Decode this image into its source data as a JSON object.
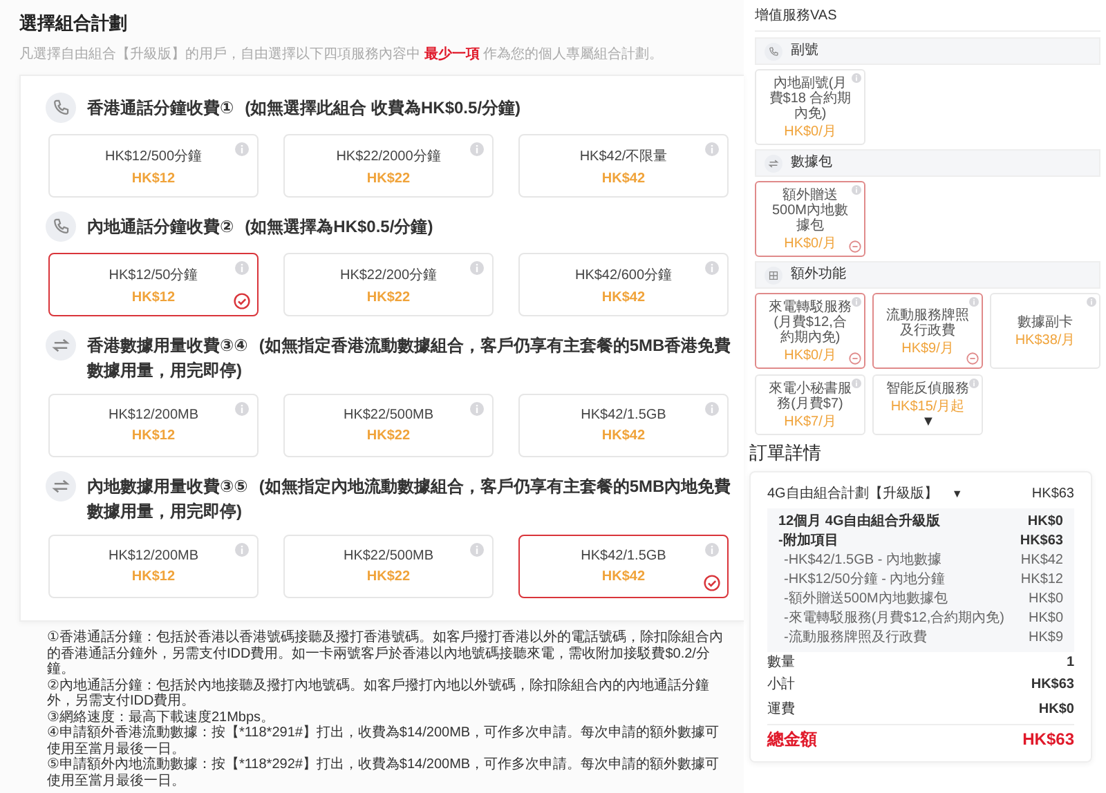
{
  "plan_section": {
    "title": "選擇組合計劃",
    "subtitle": "凡選擇自由組合【升級版】的用戶，自由選擇以下四項服務內容中 **最少一項** 作為您的個人專屬組合計劃。",
    "categories": [
      {
        "kind": "calls",
        "title": "香港通話分鐘收費①",
        "note": "(如無選擇此組合 收費為HK$0.5/分鐘)",
        "options": [
          {
            "name": "HK$12/500分鐘",
            "price": "HK$12",
            "selected": false
          },
          {
            "name": "HK$22/2000分鐘",
            "price": "HK$22",
            "selected": false
          },
          {
            "name": "HK$42/不限量",
            "price": "HK$42",
            "selected": false
          }
        ]
      },
      {
        "kind": "calls",
        "title": "內地通話分鐘收費②",
        "note": "(如無選擇為HK$0.5/分鐘)",
        "options": [
          {
            "name": "HK$12/50分鐘",
            "price": "HK$12",
            "selected": true
          },
          {
            "name": "HK$22/200分鐘",
            "price": "HK$22",
            "selected": false
          },
          {
            "name": "HK$42/600分鐘",
            "price": "HK$42",
            "selected": false
          }
        ]
      },
      {
        "kind": "data",
        "title": "香港數據用量收費③④",
        "note": "(如無指定香港流動數據組合，客戶仍享有主套餐的5MB香港免費數據用量，用完即停)",
        "options": [
          {
            "name": "HK$12/200MB",
            "price": "HK$12",
            "selected": false
          },
          {
            "name": "HK$22/500MB",
            "price": "HK$22",
            "selected": false
          },
          {
            "name": "HK$42/1.5GB",
            "price": "HK$42",
            "selected": false
          }
        ]
      },
      {
        "kind": "data",
        "title": "內地數據用量收費③⑤",
        "note": "(如無指定內地流動數據組合，客戶仍享有主套餐的5MB內地免費數據用量，用完即停)",
        "options": [
          {
            "name": "HK$12/200MB",
            "price": "HK$12",
            "selected": false
          },
          {
            "name": "HK$22/500MB",
            "price": "HK$22",
            "selected": false
          },
          {
            "name": "HK$42/1.5GB",
            "price": "HK$42",
            "selected": true
          }
        ]
      }
    ],
    "notes": [
      "①香港通話分鐘：包括於香港以香港號碼接聽及撥打香港號碼。如客戶撥打香港以外的電話號碼，除扣除組合內的香港通話分鐘外，另需支付IDD費用。如一卡兩號客戶於香港以內地號碼接聽來電，需收附加接駁費$0.2/分鐘。",
      "②內地通話分鐘：包括於內地接聽及撥打內地號碼。如客戶撥打內地以外號碼，除扣除組合內的內地通話分鐘外，另需支付IDD費用。",
      "③網絡速度：最高下載速度21Mbps。",
      "④申請額外香港流動數據：按【*118*291#】打出，收費為$14/200MB，可作多次申請。每次申請的額外數據可使用至當月最後一日。",
      "⑤申請額外內地流動數據：按【*118*292#】打出，收費為$14/200MB，可作多次申請。每次申請的額外數據可使用至當月最後一日。"
    ]
  },
  "vas": {
    "title": "增值服務VAS",
    "groups": [
      {
        "kind": "calls",
        "title": "副號",
        "items": [
          {
            "name": "內地副號(月費$18 合約期內免)",
            "price": "HK$0/月",
            "selected": false
          }
        ]
      },
      {
        "kind": "data",
        "title": "數據包",
        "items": [
          {
            "name": "額外贈送500M內地數據包",
            "price": "HK$0/月",
            "selected": true
          }
        ]
      },
      {
        "kind": "extras",
        "title": "額外功能",
        "items": [
          {
            "name": "來電轉駁服務(月費$12,合約期內免)",
            "price": "HK$0/月",
            "selected": true
          },
          {
            "name": "流動服務牌照及行政費",
            "price": "HK$9/月",
            "selected": true
          },
          {
            "name": "數據副卡",
            "price": "HK$38/月",
            "selected": false
          },
          {
            "name": "來電小秘書服務(月費$7)",
            "price": "HK$7/月",
            "selected": false
          },
          {
            "name": "智能反偵服務",
            "price": "HK$15/月起",
            "caret": "▼",
            "selected": false
          }
        ]
      }
    ]
  },
  "order": {
    "title": "訂單詳情",
    "plan": {
      "name": "4G自由組合計劃【升級版】",
      "caret": "▼",
      "price": "HK$63"
    },
    "lines": [
      {
        "label": "12個月 4G自由組合升級版",
        "price": "HK$0"
      },
      {
        "label": "-附加項目",
        "price": "HK$63",
        "children": [
          {
            "label": "-HK$42/1.5GB - 內地數據",
            "price": "HK$42"
          },
          {
            "label": "-HK$12/50分鐘 - 內地分鐘",
            "price": "HK$12"
          },
          {
            "label": "-額外贈送500M內地數據包",
            "price": "HK$0"
          },
          {
            "label": "-來電轉駁服務(月費$12,合約期內免)",
            "price": "HK$0"
          },
          {
            "label": "-流動服務牌照及行政費",
            "price": "HK$9"
          }
        ]
      }
    ],
    "quantity": {
      "label": "數量",
      "value": "1"
    },
    "subtotal": {
      "label": "小計",
      "value": "HK$63"
    },
    "shipping": {
      "label": "運費",
      "value": "HK$0"
    },
    "total": {
      "label": "總金額",
      "value": "HK$63"
    }
  }
}
